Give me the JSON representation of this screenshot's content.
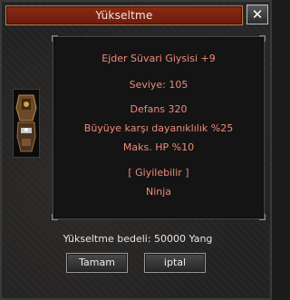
{
  "window": {
    "title": "Yükseltme",
    "close_symbol": "✕"
  },
  "item": {
    "name": "Ejder Süvari Giysisi +9",
    "level": "Seviye: 105",
    "defense": "Defans 320",
    "magic_resist": "Büyüye karşı dayanıklılık %25",
    "max_hp": "Maks. HP %10",
    "wearable": "[ Giyilebilir ]",
    "class": "Ninja",
    "icon": "armor-icon"
  },
  "footer": {
    "cost": "Yükseltme bedeli: 50000 Yang",
    "ok_label": "Tamam",
    "cancel_label": "iptal"
  },
  "colors": {
    "stat_text": "#ef8a7a",
    "title_bar": "#7a2210"
  }
}
